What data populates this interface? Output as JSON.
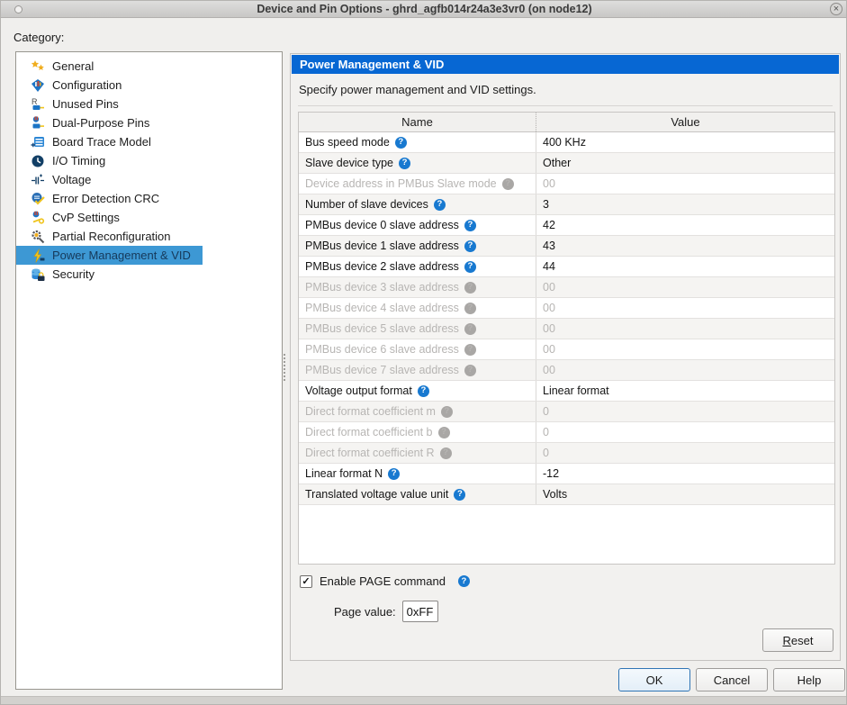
{
  "window": {
    "title": "Device and Pin Options - ghrd_agfb014r24a3e3vr0 (on node12)"
  },
  "glyphs": {
    "help": "?",
    "check": "✓",
    "close": "×"
  },
  "colors": {
    "header_blue": "#0767d3",
    "selection_blue": "#3d98d4",
    "help_blue": "#1879d0"
  },
  "category": {
    "label": "Category:",
    "items": [
      {
        "label": "General",
        "icon": "stars-icon",
        "selected": false
      },
      {
        "label": "Configuration",
        "icon": "configuration-icon",
        "selected": false
      },
      {
        "label": "Unused Pins",
        "icon": "unused-pins-icon",
        "selected": false
      },
      {
        "label": "Dual-Purpose Pins",
        "icon": "dual-purpose-pins-icon",
        "selected": false
      },
      {
        "label": "Board Trace Model",
        "icon": "board-trace-model-icon",
        "selected": false
      },
      {
        "label": "I/O Timing",
        "icon": "clock-icon",
        "selected": false
      },
      {
        "label": "Voltage",
        "icon": "voltage-icon",
        "selected": false
      },
      {
        "label": "Error Detection CRC",
        "icon": "crc-shield-icon",
        "selected": false
      },
      {
        "label": "CvP Settings",
        "icon": "cvp-settings-icon",
        "selected": false
      },
      {
        "label": "Partial Reconfiguration",
        "icon": "partial-reconfiguration-icon",
        "selected": false
      },
      {
        "label": "Power Management & VID",
        "icon": "power-bolt-icon",
        "selected": true
      },
      {
        "label": "Security",
        "icon": "security-lock-icon",
        "selected": false
      }
    ]
  },
  "panel": {
    "header": "Power Management & VID",
    "subtitle": "Specify power management and VID settings.",
    "table": {
      "columns": [
        "Name",
        "Value"
      ],
      "rows": [
        {
          "name": "Bus speed mode",
          "value": "400 KHz",
          "enabled": true
        },
        {
          "name": "Slave device type",
          "value": "Other",
          "enabled": true
        },
        {
          "name": "Device address in PMBus Slave mode",
          "value": "00",
          "enabled": false
        },
        {
          "name": "Number of slave devices",
          "value": "3",
          "enabled": true
        },
        {
          "name": "PMBus device 0 slave address",
          "value": "42",
          "enabled": true
        },
        {
          "name": "PMBus device 1 slave address",
          "value": "43",
          "enabled": true
        },
        {
          "name": "PMBus device 2 slave address",
          "value": "44",
          "enabled": true
        },
        {
          "name": "PMBus device 3 slave address",
          "value": "00",
          "enabled": false
        },
        {
          "name": "PMBus device 4 slave address",
          "value": "00",
          "enabled": false
        },
        {
          "name": "PMBus device 5 slave address",
          "value": "00",
          "enabled": false
        },
        {
          "name": "PMBus device 6 slave address",
          "value": "00",
          "enabled": false
        },
        {
          "name": "PMBus device 7 slave address",
          "value": "00",
          "enabled": false
        },
        {
          "name": "Voltage output format",
          "value": "Linear format",
          "enabled": true
        },
        {
          "name": "Direct format coefficient m",
          "value": "0",
          "enabled": false
        },
        {
          "name": "Direct format coefficient b",
          "value": "0",
          "enabled": false
        },
        {
          "name": "Direct format coefficient R",
          "value": "0",
          "enabled": false
        },
        {
          "name": "Linear format N",
          "value": "-12",
          "enabled": true
        },
        {
          "name": "Translated voltage value unit",
          "value": "Volts",
          "enabled": true
        }
      ]
    },
    "enable_page": {
      "label": "Enable PAGE command",
      "checked": true
    },
    "page_value": {
      "label": "Page value:",
      "value": "0xFF"
    },
    "reset_label": "Reset"
  },
  "footer": {
    "ok": "OK",
    "cancel": "Cancel",
    "help": "Help"
  }
}
